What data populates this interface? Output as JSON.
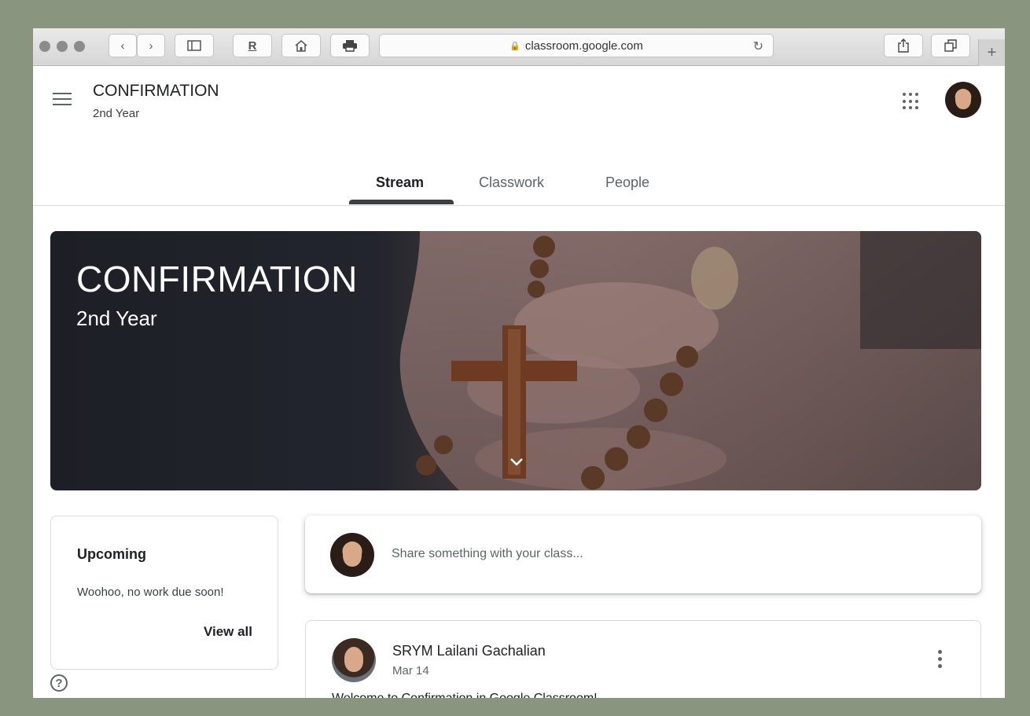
{
  "browser": {
    "url": "classroom.google.com"
  },
  "header": {
    "class_name": "CONFIRMATION",
    "class_section": "2nd Year"
  },
  "tabs": [
    {
      "label": "Stream",
      "active": true
    },
    {
      "label": "Classwork",
      "active": false
    },
    {
      "label": "People",
      "active": false
    }
  ],
  "banner": {
    "title": "CONFIRMATION",
    "subtitle": "2nd Year"
  },
  "upcoming": {
    "title": "Upcoming",
    "empty_message": "Woohoo, no work due soon!",
    "view_all_label": "View all"
  },
  "share": {
    "placeholder": "Share something with your class..."
  },
  "post": {
    "author": "SRYM Lailani Gachalian",
    "date": "Mar 14",
    "body": "Welcome to Confirmation in Google Classroom!"
  },
  "icons": {
    "help": "?"
  },
  "colors": {
    "backdrop": "#8a9580",
    "active_tab_indicator": "#3c4043"
  }
}
